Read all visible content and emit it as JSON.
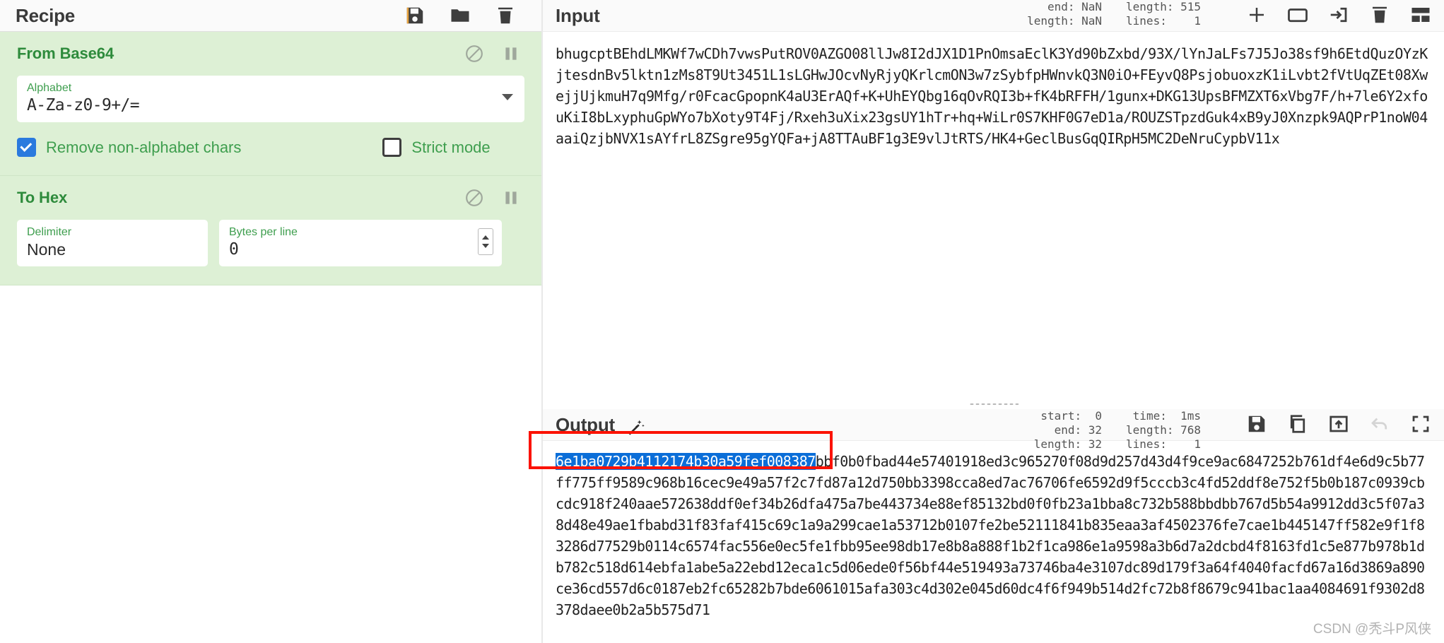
{
  "recipe": {
    "title": "Recipe",
    "icons": [
      {
        "name": "save-icon",
        "label": "Save recipe"
      },
      {
        "name": "folder-icon",
        "label": "Load recipe"
      },
      {
        "name": "trash-icon",
        "label": "Clear recipe"
      }
    ],
    "operations": [
      {
        "title": "From Base64",
        "disable_label": "Disable operation",
        "pause_label": "Set breakpoint",
        "args": [
          {
            "label": "Alphabet",
            "value": "A-Za-z0-9+/=",
            "type": "select"
          }
        ],
        "checkboxes": [
          {
            "label": "Remove non-alphabet chars",
            "checked": true
          },
          {
            "label": "Strict mode",
            "checked": false
          }
        ]
      },
      {
        "title": "To Hex",
        "disable_label": "Disable operation",
        "pause_label": "Set breakpoint",
        "args": [
          {
            "label": "Delimiter",
            "value": "None",
            "type": "select"
          },
          {
            "label": "Bytes per line",
            "value": "0",
            "type": "number"
          }
        ],
        "checkboxes": []
      }
    ]
  },
  "input": {
    "title": "Input",
    "status": {
      "col1": "end: NaN\nlength: NaN",
      "col2": "length: 515\nlines:    1"
    },
    "icons": [
      {
        "name": "add-tab-icon",
        "label": "Add a new input"
      },
      {
        "name": "folder-open-icon",
        "label": "Open file as input"
      },
      {
        "name": "open-folder-as-input-icon",
        "label": "Open folder as input"
      },
      {
        "name": "trash-icon",
        "label": "Clear input and output"
      },
      {
        "name": "reset-layout-icon",
        "label": "Reset pane layout"
      }
    ],
    "text": "bhugcptBEhdLMKWf7wCDh7vwsPutROV0AZGO08llJw8I2dJX1D1PnOmsaEclK3Yd90bZxbd/93X/lYnJaLFs7J5Jo38sf9h6EtdQuzOYzKjtesdnBv5lktn1zMs8T9Ut3451L1sLGHwJOcvNyRjyQKrlcmON3w7zSybfpHWnvkQ3N0iO+FEyvQ8PsjobuoxzK1iLvbt2fVtUqZEt08XwejjUjkmuH7q9Mfg/r0FcacGpopnK4aU3ErAQf+K+UhEYQbg16qOvRQI3b+fK4bRFFH/1gunx+DKG13UpsBFMZXT6xVbg7F/h+7le6Y2xfouKiI8bLxyphuGpWYo7bXoty9T4Fj/Rxeh3uXix23gsUY1hTr+hq+WiLr0S7KHF0G7eD1a/ROUZSTpzdGuk4xB9yJ0Xnzpk9AQPrP1noW04aaiQzjbNVX1sAYfrL8ZSgre95gYQFa+jA8TTAuBF1g3E9vlJtRTS/HK4+GeclBusGqQIRpH5MC2DeNruCypbV11x"
  },
  "output": {
    "title": "Output",
    "magic_icon_label": "magic-wand",
    "status": {
      "col1": "start:  0\nend: 32\nlength: 32",
      "col2": "time:  1ms\nlength: 768\nlines:    1"
    },
    "icons": [
      {
        "name": "save-icon",
        "label": "Save output to file"
      },
      {
        "name": "copy-icon",
        "label": "Copy raw output to the clipboard"
      },
      {
        "name": "replace-input-icon",
        "label": "Replace input with output"
      },
      {
        "name": "undo-icon",
        "label": "Undo"
      },
      {
        "name": "maximise-icon",
        "label": "Maximise output pane"
      }
    ],
    "selected_text": "6e1ba0729b4112174b30a59fef008387",
    "rest_text": "bbf0b0fbad44e57401918ed3c965270f08d9d257d43d4f9ce9ac6847252b761df4e6d9c5b77ff775ff9589c968b16cec9e49a57f2c7fd87a12d750bb3398cca8ed7ac76706fe6592d9f5cccb3c4fd52ddf8e752f5b0b187c0939cbcdc918f240aae572638ddf0ef34b26dfa475a7be443734e88ef85132bd0f0fb23a1bba8c732b588bbdbb767d5b54a9912dd3c5f07a38d48e49ae1fbabd31f83faf415c69c1a9a299cae1a53712b0107fe2be52111841b835eaa3af4502376fe7cae1b445147ff582e9f1f83286d77529b0114c6574fac556e0ec5fe1fbb95ee98db17e8b8a888f1b2f1ca986e1a9598a3b6d7a2dcbd4f8163fd1c5e877b978b1db782c518d614ebfa1abe5a22ebd12eca1c5d06ede0f56bf44e519493a73746ba4e3107dc89d179f3a64f4040facfd67a16d3869a890ce36cd557d6c0187eb2fc65282b7bde6061015afa303c4d302e045d60dc4f6f949b514d2fc72b8f8679c941bac1aa4084691f9302d8378daee0b2a5b575d71"
  },
  "annotation": {
    "highlight_color": "#fb1202"
  },
  "watermark": "CSDN @秃斗P风侠"
}
